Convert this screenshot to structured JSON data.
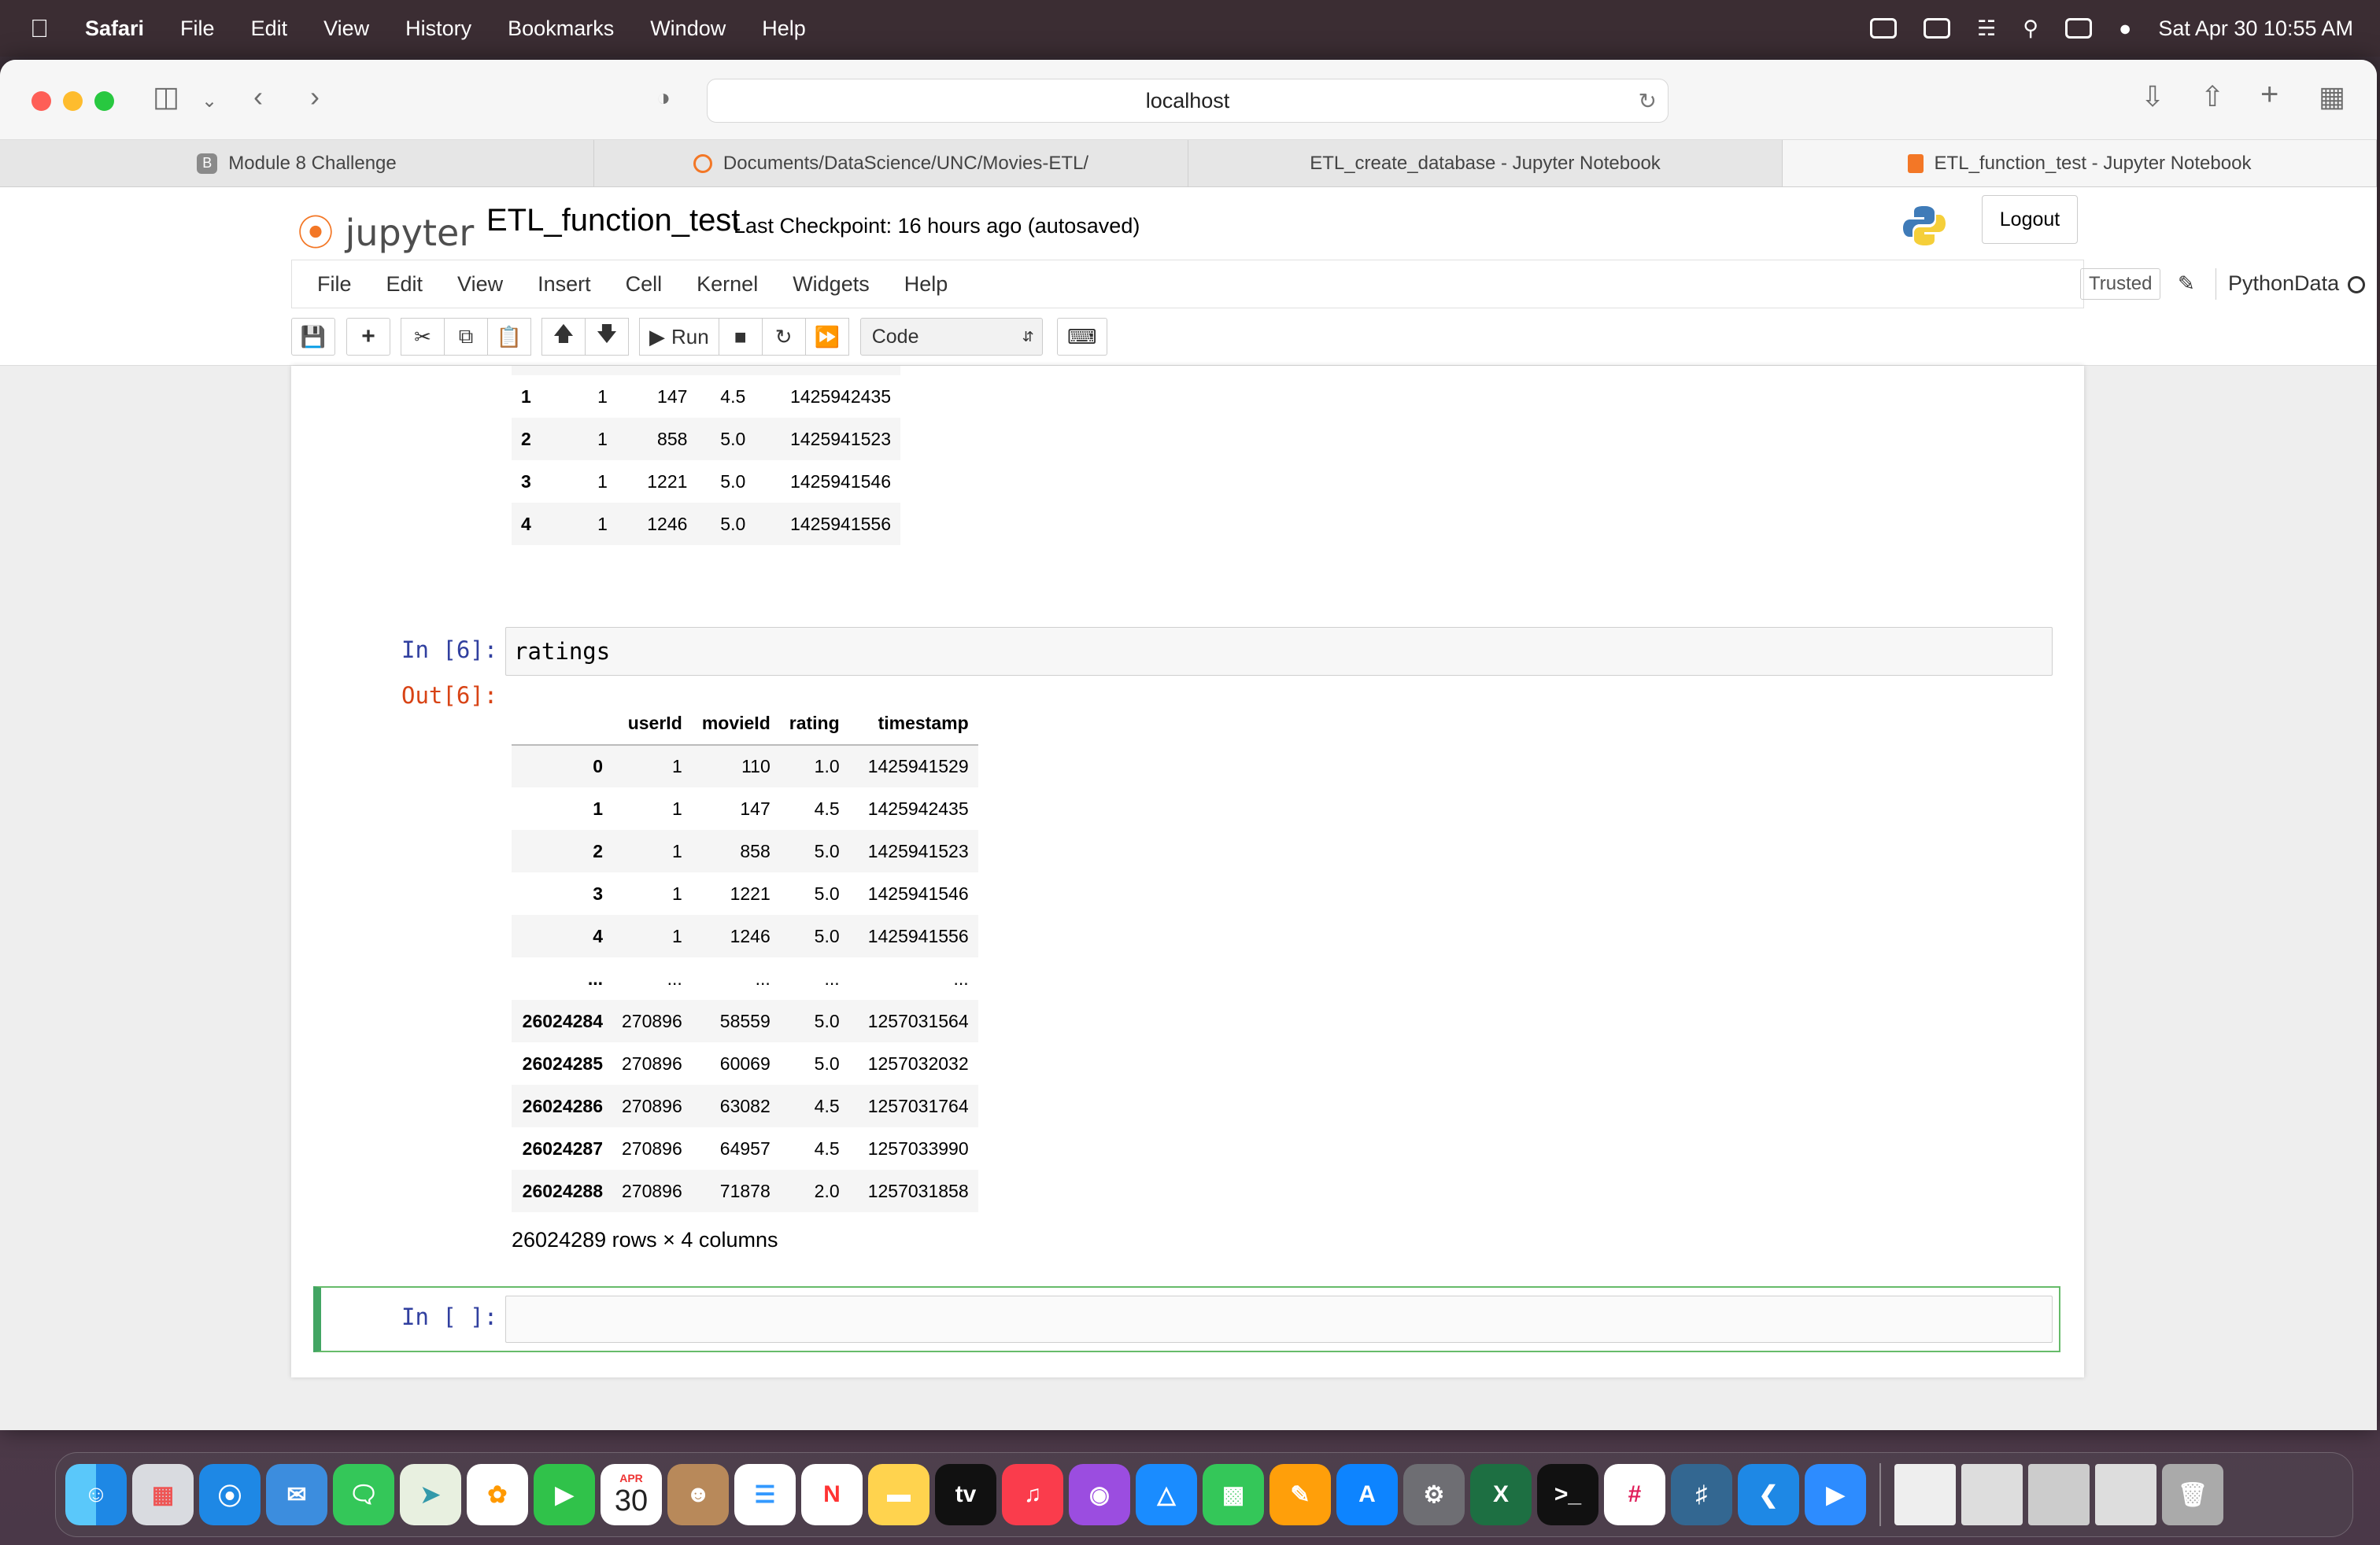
{
  "menubar": {
    "apple": "",
    "app": "Safari",
    "items": [
      "File",
      "Edit",
      "View",
      "History",
      "Bookmarks",
      "Window",
      "Help"
    ],
    "datetime": "Sat Apr 30  10:55 AM"
  },
  "browser": {
    "url": "localhost",
    "tabs": [
      {
        "label": "Module 8 Challenge",
        "icon": "B"
      },
      {
        "label": "Documents/DataScience/UNC/Movies-ETL/",
        "icon": ""
      },
      {
        "label": "ETL_create_database - Jupyter Notebook",
        "icon": ""
      },
      {
        "label": "ETL_function_test - Jupyter Notebook",
        "icon": ""
      }
    ]
  },
  "jupyter": {
    "logo": "jupyter",
    "notebook_title": "ETL_function_test",
    "checkpoint": "Last Checkpoint: 16 hours ago  (autosaved)",
    "logout": "Logout",
    "menu": [
      "File",
      "Edit",
      "View",
      "Insert",
      "Cell",
      "Kernel",
      "Widgets",
      "Help"
    ],
    "trusted": "Trusted",
    "kernel": "PythonData",
    "run_label": "Run",
    "cell_type": "Code"
  },
  "prev_output": {
    "rows": [
      [
        "1",
        "1",
        "147",
        "4.5",
        "1425942435"
      ],
      [
        "2",
        "1",
        "858",
        "5.0",
        "1425941523"
      ],
      [
        "3",
        "1",
        "1221",
        "5.0",
        "1425941546"
      ],
      [
        "4",
        "1",
        "1246",
        "5.0",
        "1425941556"
      ]
    ]
  },
  "cell6": {
    "in_prompt": "In [6]:",
    "code": "ratings",
    "out_prompt": "Out[6]:",
    "columns": [
      "",
      "userId",
      "movieId",
      "rating",
      "timestamp"
    ],
    "rows": [
      [
        "0",
        "1",
        "110",
        "1.0",
        "1425941529"
      ],
      [
        "1",
        "1",
        "147",
        "4.5",
        "1425942435"
      ],
      [
        "2",
        "1",
        "858",
        "5.0",
        "1425941523"
      ],
      [
        "3",
        "1",
        "1221",
        "5.0",
        "1425941546"
      ],
      [
        "4",
        "1",
        "1246",
        "5.0",
        "1425941556"
      ],
      [
        "...",
        "...",
        "...",
        "...",
        "..."
      ],
      [
        "26024284",
        "270896",
        "58559",
        "5.0",
        "1257031564"
      ],
      [
        "26024285",
        "270896",
        "60069",
        "5.0",
        "1257032032"
      ],
      [
        "26024286",
        "270896",
        "63082",
        "4.5",
        "1257031764"
      ],
      [
        "26024287",
        "270896",
        "64957",
        "4.5",
        "1257033990"
      ],
      [
        "26024288",
        "270896",
        "71878",
        "2.0",
        "1257031858"
      ]
    ],
    "shape": "26024289 rows × 4 columns"
  },
  "empty_cell": {
    "in_prompt": "In [ ]:"
  },
  "dock_date": {
    "month": "APR",
    "day": "30"
  }
}
